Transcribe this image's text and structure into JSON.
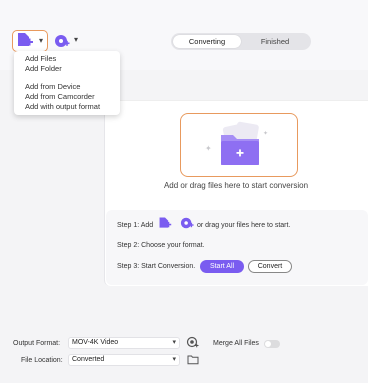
{
  "toolbar": {
    "add_files_icon": "add-file-icon",
    "dvd_icon": "dvd-icon",
    "tabs": [
      {
        "label": "Converting",
        "active": true
      },
      {
        "label": "Finished",
        "active": false
      }
    ]
  },
  "add_menu": {
    "items": [
      "Add Files",
      "Add Folder",
      "Add from Device",
      "Add from Camcorder",
      "Add with output format"
    ]
  },
  "drop_area": {
    "text": "Add or drag files here to start conversion"
  },
  "steps": {
    "step1_prefix": "Step 1: Add",
    "step1_suffix": "or drag your files here to start.",
    "step2": "Step 2: Choose your format.",
    "step3": "Step 3: Start Conversion.",
    "start_all": "Start  All",
    "convert": "Convert"
  },
  "footer": {
    "output_format_label": "Output Format:",
    "output_format_value": "MOV-4K Video",
    "merge_label": "Merge All Files",
    "merge_enabled": false,
    "file_location_label": "File Location:",
    "file_location_value": "Converted"
  },
  "colors": {
    "accent": "#7a5cf0",
    "highlight_border": "#e89a5e"
  }
}
